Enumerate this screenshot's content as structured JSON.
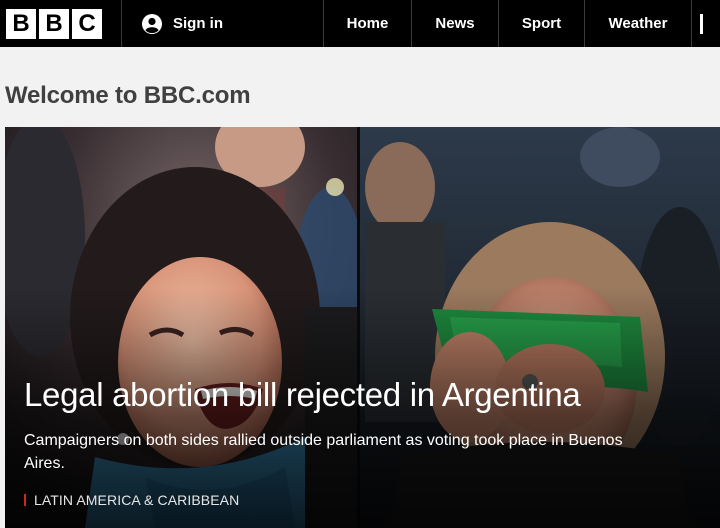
{
  "header": {
    "logo": {
      "letters": [
        "B",
        "B",
        "C"
      ]
    },
    "signin_label": "Sign in",
    "nav": [
      {
        "label": "Home"
      },
      {
        "label": "News"
      },
      {
        "label": "Sport"
      },
      {
        "label": "Weather"
      }
    ]
  },
  "page": {
    "welcome_title": "Welcome to BBC.com"
  },
  "hero": {
    "headline": "Legal abortion bill rejected in Argentina",
    "summary": "Campaigners on both sides rallied outside parliament as voting took place in Buenos Aires.",
    "section_label": "LATIN AMERICA & CARIBBEAN"
  },
  "icons": {
    "user": "user-icon",
    "section_marker": "section-marker-icon"
  },
  "colors": {
    "header_bg": "#000000",
    "page_bg": "#f2f2f2",
    "title_text": "#404040",
    "section_accent": "#d0271d"
  }
}
